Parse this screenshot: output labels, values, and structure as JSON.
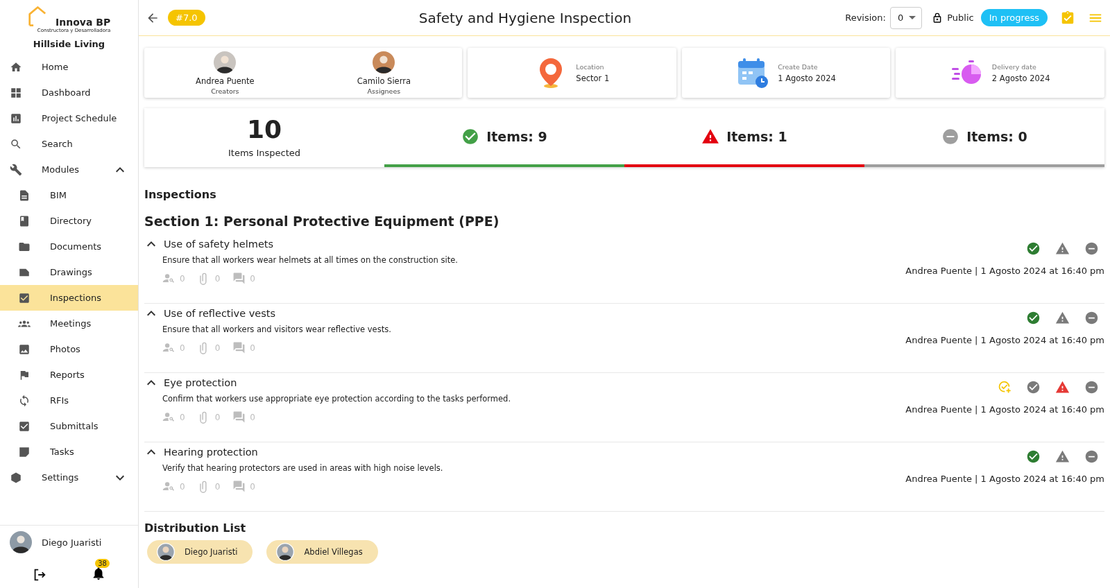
{
  "sidebar": {
    "logo": {
      "name": "Innova BP",
      "tagline": "Constructora y Desarrolladora"
    },
    "project": "Hillside Living",
    "items": [
      {
        "label": "Home",
        "selected": false
      },
      {
        "label": "Dashboard",
        "selected": false
      },
      {
        "label": "Project Schedule",
        "selected": false
      },
      {
        "label": "Search",
        "selected": false
      },
      {
        "label": "Modules",
        "selected": false,
        "expanded": true,
        "children": [
          {
            "label": "BIM",
            "selected": false
          },
          {
            "label": "Directory",
            "selected": false
          },
          {
            "label": "Documents",
            "selected": false
          },
          {
            "label": "Drawings",
            "selected": false
          },
          {
            "label": "Inspections",
            "selected": true
          },
          {
            "label": "Meetings",
            "selected": false
          },
          {
            "label": "Photos",
            "selected": false
          },
          {
            "label": "Reports",
            "selected": false
          },
          {
            "label": "RFIs",
            "selected": false
          },
          {
            "label": "Submittals",
            "selected": false
          },
          {
            "label": "Tasks",
            "selected": false
          }
        ]
      },
      {
        "label": "Settings",
        "selected": false,
        "expanded": false
      }
    ],
    "user": {
      "name": "Diego Juaristi"
    },
    "notifications": "38"
  },
  "header": {
    "badge": "#7.0",
    "title": "Safety and Hygiene Inspection",
    "revision_label": "Revision:",
    "revision": "0",
    "visibility": "Public",
    "status": "In progress"
  },
  "people": [
    {
      "name": "Andrea Puente",
      "role": "Creators"
    },
    {
      "name": "Camilo Sierra",
      "role": "Assignees"
    }
  ],
  "info_cards": [
    {
      "kind": "location",
      "label": "Location",
      "value": "Sector 1"
    },
    {
      "kind": "create",
      "label": "Create Date",
      "value": "1 Agosto 2024"
    },
    {
      "kind": "delivery",
      "label": "Delivery date",
      "value": "2 Agosto 2024"
    }
  ],
  "stats": {
    "total": "10",
    "total_label": "Items Inspected",
    "groups": [
      {
        "kind": "pass",
        "label": "Items: 9",
        "color": "#43a047"
      },
      {
        "kind": "fail",
        "label": "Items: 1",
        "color": "#e3000f"
      },
      {
        "kind": "na",
        "label": "Items: 0",
        "color": "#9e9e9e"
      }
    ]
  },
  "inspections_title": "Inspections",
  "section_title": "Section 1: Personal Protective Equipment (PPE)",
  "items": [
    {
      "title": "Use of safety helmets",
      "expanded": true,
      "description": "Ensure that all workers wear helmets at all times on the construction site.",
      "assignees": "0",
      "attachments": "0",
      "comments": "0",
      "pass": true,
      "fail": false,
      "na": false,
      "flagged": false,
      "author": "Andrea Puente | 1 Agosto 2024 at 16:40 pm"
    },
    {
      "title": "Use of reflective vests",
      "expanded": true,
      "description": "Ensure that all workers and visitors wear reflective vests.",
      "assignees": "0",
      "attachments": "0",
      "comments": "0",
      "pass": true,
      "fail": false,
      "na": false,
      "flagged": false,
      "author": "Andrea Puente | 1 Agosto 2024 at 16:40 pm"
    },
    {
      "title": "Eye protection",
      "expanded": true,
      "description": "Confirm that workers use appropriate eye protection according to the tasks performed.",
      "assignees": "0",
      "attachments": "0",
      "comments": "0",
      "pass": false,
      "fail": true,
      "na": false,
      "flagged": true,
      "author": "Andrea Puente | 1 Agosto 2024 at 16:40 pm"
    },
    {
      "title": "Hearing protection",
      "expanded": true,
      "description": "Verify that hearing protectors are used in areas with high noise levels.",
      "assignees": "0",
      "attachments": "0",
      "comments": "0",
      "pass": true,
      "fail": false,
      "na": false,
      "flagged": false,
      "author": "Andrea Puente | 1 Agosto 2024 at 16:40 pm"
    }
  ],
  "distribution": {
    "title": "Distribution List",
    "people": [
      {
        "name": "Diego Juaristi"
      },
      {
        "name": "Abdiel Villegas"
      }
    ]
  }
}
